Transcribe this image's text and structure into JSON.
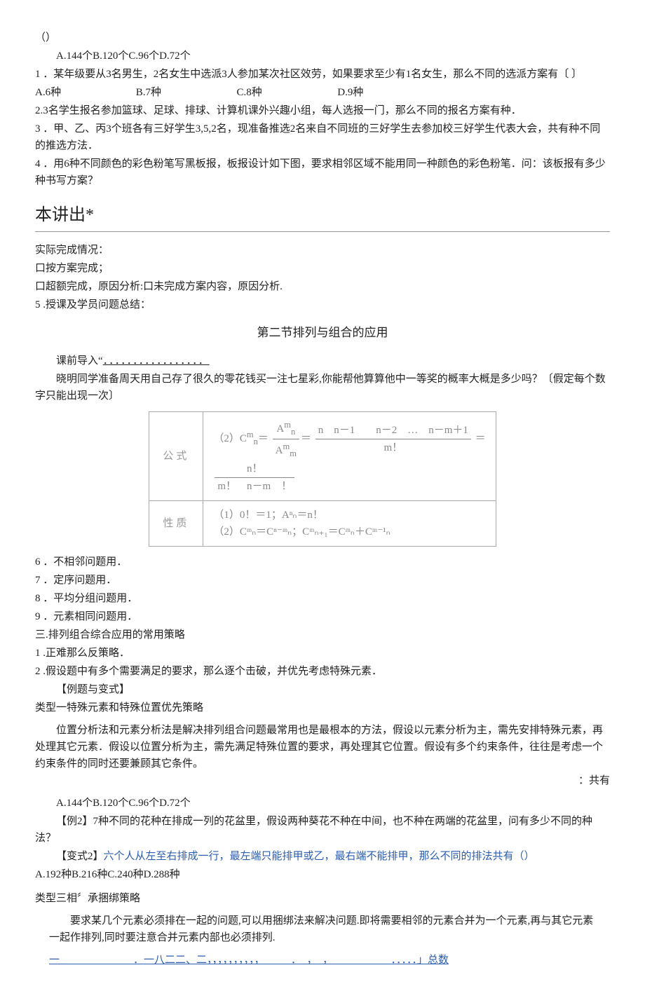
{
  "top": {
    "paren": "（）",
    "options_line": "A.144个B.120个C.96个D.72个",
    "q1": "1 ．某年级要从3名男生，2名女生中选派3人参加某次社区效劳，如果要求至少有1名女生，那么不同的选派方案有〔 〕",
    "q1_opts": {
      "a": "A.6种",
      "b": "B.7种",
      "c": "C.8种",
      "d": "D.9种"
    },
    "q2": "2.3名学生报名参加篮球、足球、排球、计算机课外兴趣小组，每人选报一门，那么不同的报名方案有种．",
    "q3": "3 ．甲、乙、丙3个班各有三好学生3,5,2名，现准备推选2名来自不同班的三好学生去参加校三好学生代表大会，共有种不同的推选方法．",
    "q4": "4 ．用6种不同颜色的彩色粉笔写黑板报，板报设计如下图，要求相邻区域不能用同一种颜色的彩色粉笔．问：该板报有多少种书写方案？"
  },
  "section1_title": "本讲出*",
  "completion": {
    "l1": "实际完成情况：",
    "l2": "口按方案完成；",
    "l3": "口超额完成，原因分析:口未完成方案内容，原因分析.",
    "l4": "5 .授课及学员问题总结："
  },
  "section2_title": "第二节排列与组合的应用",
  "lead": {
    "label": "课前导入“",
    "dots": "．．．．．．．．．．．．．．．．．",
    "para": "晓明同学准备周天用自己存了很久的零花钱买一注七星彩,你能帮他算算他中一等奖的概率大概是多少吗？〔假定每个数字只能出现一次〕"
  },
  "table": {
    "row1_label": "公式",
    "row1_prefix": "（2）C",
    "row1_num_long": "n　n－1　　n－2　…　n－m＋1",
    "row1_den_long": "m！",
    "row1_eq": "＝",
    "row1b_num": "n！",
    "row1b_den": "m！　n－m　！",
    "row2_label": "性质",
    "row2_l1": "（1）0！＝1；Aⁿₙ＝n！",
    "row2_l2": "（2）Cᵐₙ＝Cⁿ⁻ᵐₙ；Cᵐₙ₊₁＝Cᵐₙ＋Cᵐ⁻¹ₙ"
  },
  "list": {
    "i6": "6 ．不相邻问题用．",
    "i7": "7 ．定序问题用．",
    "i8": "8 ．平均分组问题用．",
    "i9": "9 ．元素相同问题用．",
    "s3": "三.排列组合综合应用的常用策略",
    "s3_1": "1 .正难那么反策略．",
    "s3_2": "2 .假设题中有多个需要满足的要求，那么逐个击破，并优先考虑特殊元素．",
    "ex_label": "【例题与变式】",
    "type1": "类型一特殊元素和特殊位置优先策略"
  },
  "analysis": {
    "p1": "位置分析法和元素分析法是解决排列组合问题最常用也是最根本的方法，假设以元素分析为主，需先安排特殊元素，再处理其它元素．假设以位置分析为主，需先满足特殊位置的要求，再处理其它位置。假设有多个约束条件，往往是考虑一个约束条件的同时还要兼顾其它条件。",
    "tail": "：共有",
    "opts": "A.144个B.120个C.96个D.72个"
  },
  "ex2": {
    "q": "【例2】7种不同的花种在排成一列的花盆里，假设两种葵花不种在中间，也不种在两端的花盆里，问有多少不同的种法？",
    "var2": "【变式2】",
    "var2_body": "六个人从左至右排成一行，最左端只能排甲或乙，最右端不能排甲，那么不同的排法共有（）",
    "var2_opts": "A.192种B.216种C.240种D.288种"
  },
  "type3": {
    "title": "类型三相〞承捆绑策略",
    "p1": "要求某几个元素必须排在一起的问题,可以用捆绑法来解决问题.即将需要相邻的元素合并为一个元素,再与其它元素一起作排列,同时要注意合并元素内部也必须排列.",
    "linkline": "一　　　　　　　．一八二二、二，，，，，，，，，，　　　．　，　，　　　　　　．．．．．」总数"
  }
}
